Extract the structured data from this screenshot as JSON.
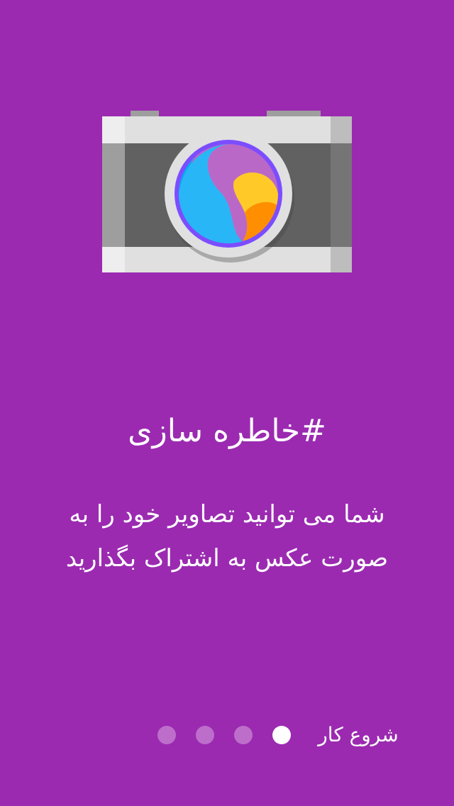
{
  "colors": {
    "background": "#9B2AB1",
    "text": "#FFFFFF",
    "dot_active": "#FFFFFF",
    "dot_inactive": "#BD6ECB"
  },
  "hero": {
    "icon": "camera-icon"
  },
  "content": {
    "title": "#خاطره سازی",
    "description": "شما می توانید تصاویر خود را به صورت عکس به اشتراک بگذارید"
  },
  "footer": {
    "start_label": "شروع کار",
    "page_indicator": {
      "total": 4,
      "active": 4
    }
  }
}
